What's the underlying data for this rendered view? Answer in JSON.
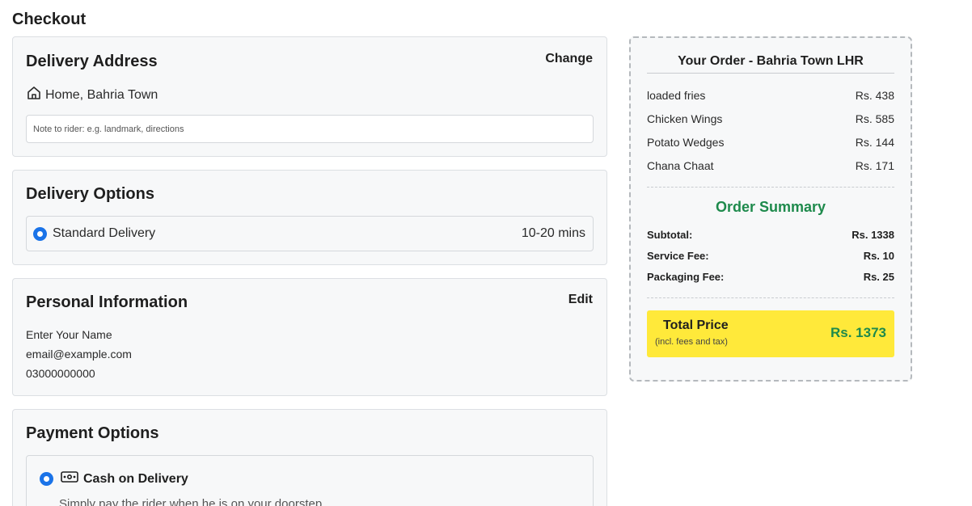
{
  "page": {
    "title": "Checkout"
  },
  "address": {
    "title": "Delivery Address",
    "change_label": "Change",
    "address_text": "Home, Bahria Town",
    "note_placeholder": "Note to rider: e.g. landmark, directions",
    "note_value": ""
  },
  "delivery": {
    "title": "Delivery Options",
    "option_label": "Standard Delivery",
    "option_time": "10-20 mins",
    "selected": true
  },
  "personal": {
    "title": "Personal Information",
    "edit_label": "Edit",
    "name": "Enter Your Name",
    "email": "email@example.com",
    "phone": "03000000000"
  },
  "payment": {
    "title": "Payment Options",
    "option_label": "Cash on Delivery",
    "option_desc": "Simply pay the rider when he is on your doorstep",
    "selected": true
  },
  "order": {
    "title": "Your Order - Bahria Town LHR",
    "items": [
      {
        "name": "loaded fries",
        "price": "Rs. 438"
      },
      {
        "name": "Chicken Wings",
        "price": "Rs. 585"
      },
      {
        "name": "Potato Wedges",
        "price": "Rs. 144"
      },
      {
        "name": "Chana Chaat",
        "price": "Rs. 171"
      }
    ],
    "summary_title": "Order Summary",
    "fees": [
      {
        "label": "Subtotal:",
        "value": "Rs. 1338"
      },
      {
        "label": "Service Fee:",
        "value": "Rs. 10"
      },
      {
        "label": "Packaging Fee:",
        "value": "Rs. 25"
      }
    ],
    "total_label": "Total Price",
    "total_sub": "(incl. fees and tax)",
    "total_value": "Rs. 1373"
  },
  "colors": {
    "accent_blue": "#1a73e8",
    "summary_green": "#1e8a4c",
    "total_yellow": "#ffe93a"
  },
  "icons": {
    "address": "home-icon",
    "payment": "cash-icon"
  }
}
